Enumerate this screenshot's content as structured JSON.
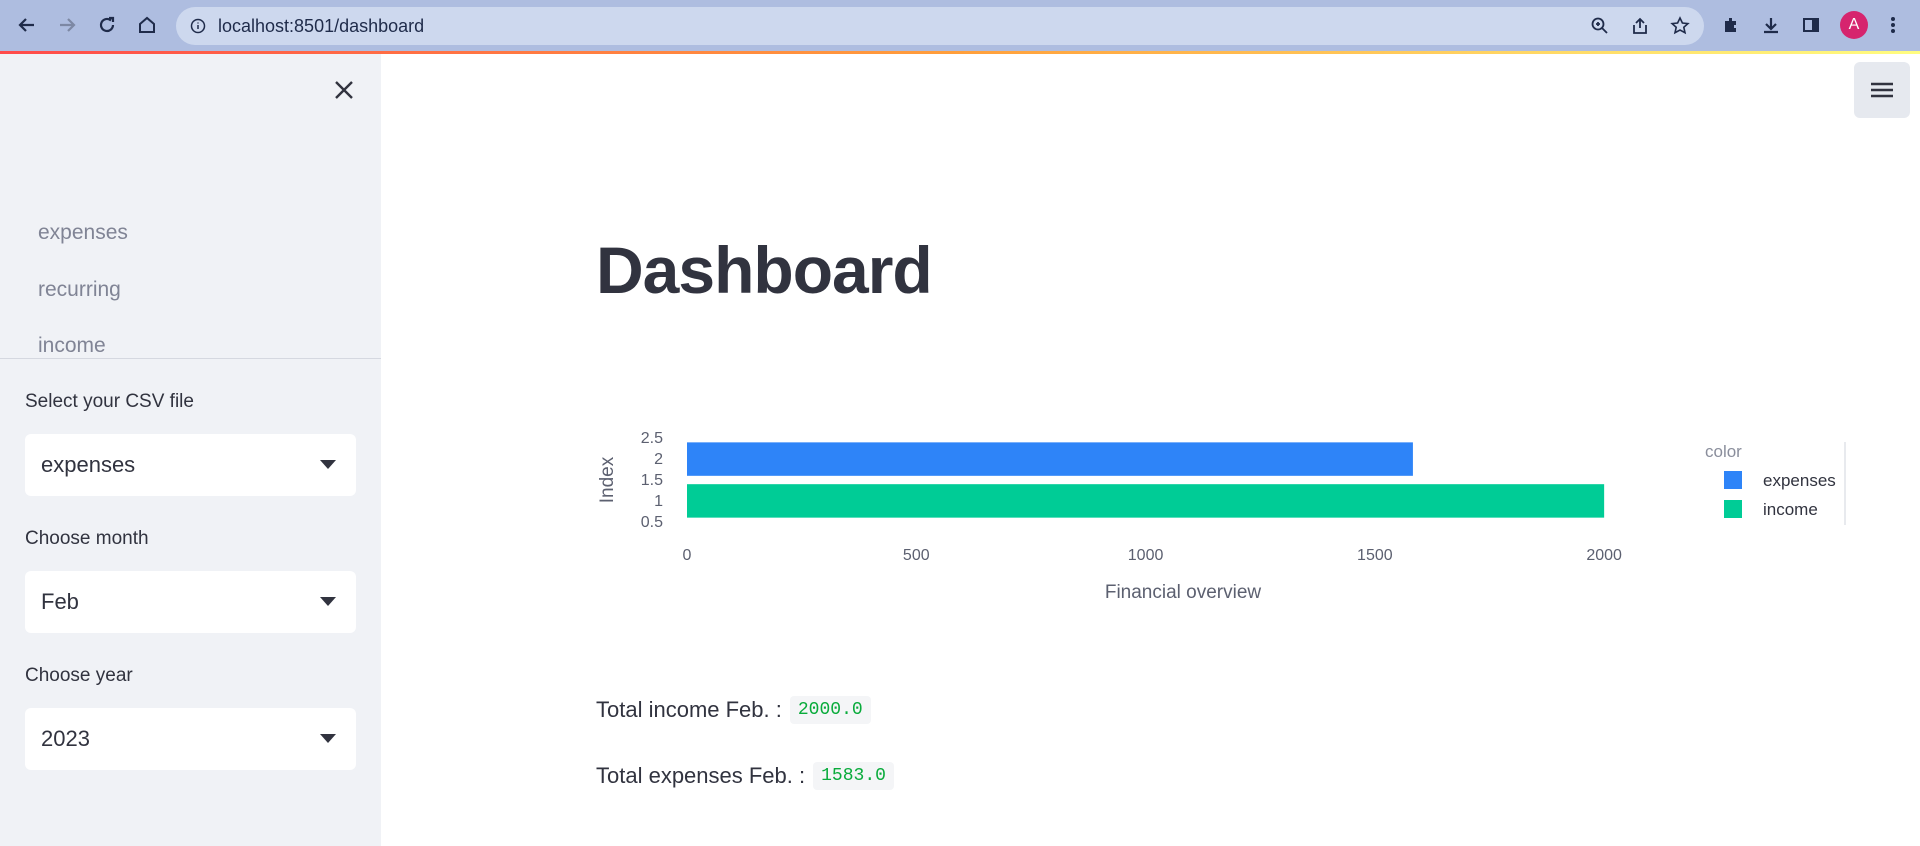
{
  "browser": {
    "url": "localhost:8501/dashboard",
    "avatar_initial": "A"
  },
  "sidebar": {
    "nav_items": [
      {
        "label": "expenses"
      },
      {
        "label": "recurring"
      },
      {
        "label": "income"
      }
    ],
    "csv_label": "Select your CSV file",
    "csv_value": "expenses",
    "month_label": "Choose month",
    "month_value": "Feb",
    "year_label": "Choose year",
    "year_value": "2023"
  },
  "main": {
    "title": "Dashboard",
    "stats": [
      {
        "label": "Total income Feb. :",
        "value": "2000.0"
      },
      {
        "label": "Total expenses Feb. :",
        "value": "1583.0"
      }
    ]
  },
  "chart_data": {
    "type": "bar",
    "orientation": "horizontal",
    "xlabel": "Financial overview",
    "ylabel": "Index",
    "xlim": [
      0,
      2100
    ],
    "ylim": [
      0.4,
      2.6
    ],
    "xticks": [
      0,
      500,
      1000,
      1500,
      2000
    ],
    "yticks": [
      2.5,
      2,
      1.5,
      1,
      0.5
    ],
    "legend_title": "color",
    "legend_position": "right",
    "series": [
      {
        "name": "expenses",
        "index": 2,
        "value": 1583,
        "color": "#2e84f8"
      },
      {
        "name": "income",
        "index": 1,
        "value": 2000,
        "color": "#00cc96"
      }
    ]
  }
}
